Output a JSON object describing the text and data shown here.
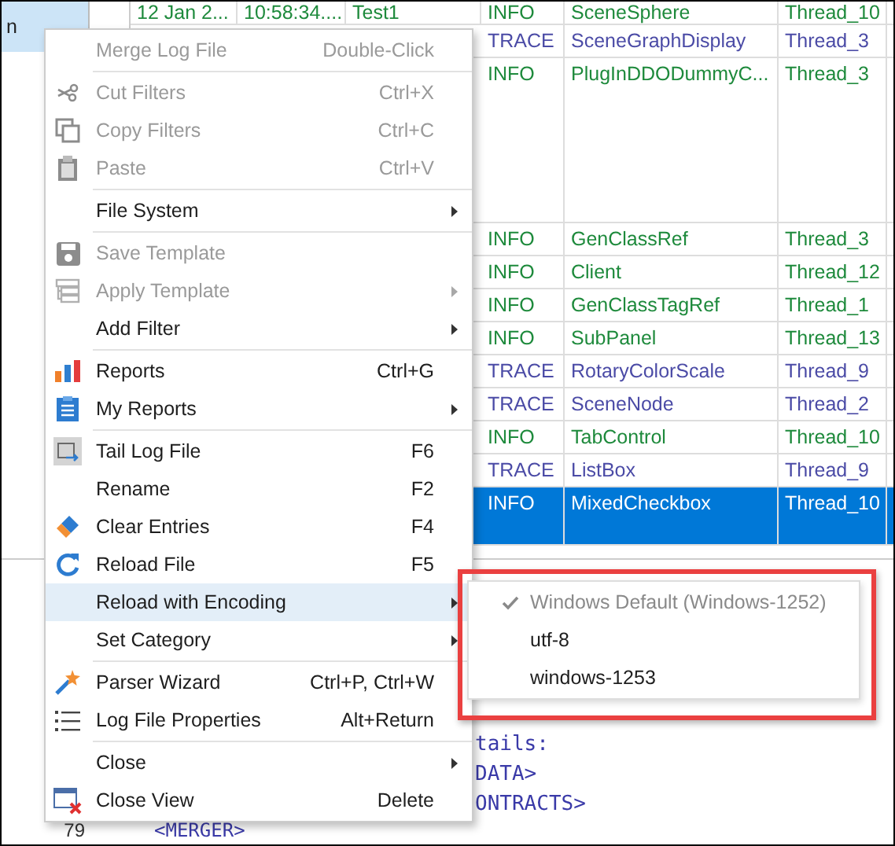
{
  "left_panel": {
    "items": [
      {
        "label": "n",
        "selected": true
      }
    ]
  },
  "table": {
    "rows": [
      {
        "cells": [
          "12 Jan 2...",
          "10:58:34....",
          "Test1",
          "INFO",
          "SceneSphere",
          "Thread_10"
        ],
        "color": "#1e8a3c",
        "kind": "cut",
        "selected": false
      },
      {
        "cells": [
          "TRACE",
          "SceneGraphDisplay",
          "Thread_3"
        ],
        "color": "#4b4ba6",
        "kind": "single",
        "selected": false
      },
      {
        "cells": [
          "INFO",
          "PlugInDDODummyC...",
          "Thread_3"
        ],
        "color": "#1e8a3c",
        "kind": "multi",
        "selected": false
      },
      {
        "cells": [
          "INFO",
          "GenClassRef",
          "Thread_3"
        ],
        "color": "#1e8a3c",
        "kind": "single",
        "selected": false
      },
      {
        "cells": [
          "INFO",
          "Client",
          "Thread_12"
        ],
        "color": "#1e8a3c",
        "kind": "single",
        "selected": false
      },
      {
        "cells": [
          "INFO",
          "GenClassTagRef",
          "Thread_1"
        ],
        "color": "#1e8a3c",
        "kind": "single",
        "selected": false
      },
      {
        "cells": [
          "INFO",
          "SubPanel",
          "Thread_13"
        ],
        "color": "#1e8a3c",
        "kind": "single",
        "selected": false
      },
      {
        "cells": [
          "TRACE",
          "RotaryColorScale",
          "Thread_9"
        ],
        "color": "#4b4ba6",
        "kind": "single",
        "selected": false
      },
      {
        "cells": [
          "TRACE",
          "SceneNode",
          "Thread_2"
        ],
        "color": "#4b4ba6",
        "kind": "single",
        "selected": false
      },
      {
        "cells": [
          "INFO",
          "TabControl",
          "Thread_10"
        ],
        "color": "#1e8a3c",
        "kind": "single",
        "selected": false
      },
      {
        "cells": [
          "TRACE",
          "ListBox",
          "Thread_9"
        ],
        "color": "#4b4ba6",
        "kind": "single",
        "selected": false
      },
      {
        "cells": [
          "INFO",
          "MixedCheckbox",
          "Thread_10"
        ],
        "kind": "double",
        "selected": true
      }
    ]
  },
  "editor": {
    "lines": [
      "tails:",
      "DATA>",
      "ONTRACTS>"
    ],
    "last_line": {
      "number": "79",
      "text": "<MERGER>"
    }
  },
  "menu": {
    "items": [
      {
        "kind": "item",
        "label": "Merge Log File",
        "shortcut": "Double-Click",
        "disabled": true,
        "submenu": false,
        "selected": false
      },
      {
        "kind": "separator"
      },
      {
        "kind": "item",
        "label": "Cut Filters",
        "shortcut": "Ctrl+X",
        "disabled": true,
        "submenu": false,
        "selected": false
      },
      {
        "kind": "item",
        "label": "Copy Filters",
        "shortcut": "Ctrl+C",
        "disabled": true,
        "submenu": false,
        "selected": false
      },
      {
        "kind": "item",
        "label": "Paste",
        "shortcut": "Ctrl+V",
        "disabled": true,
        "submenu": false,
        "selected": false
      },
      {
        "kind": "separator"
      },
      {
        "kind": "item",
        "label": "File System",
        "disabled": false,
        "submenu": true,
        "selected": false
      },
      {
        "kind": "separator"
      },
      {
        "kind": "item",
        "label": "Save Template",
        "disabled": true,
        "submenu": false,
        "selected": false
      },
      {
        "kind": "item",
        "label": "Apply Template",
        "disabled": true,
        "submenu": true,
        "selected": false
      },
      {
        "kind": "item",
        "label": "Add Filter",
        "disabled": false,
        "submenu": true,
        "selected": false
      },
      {
        "kind": "separator"
      },
      {
        "kind": "item",
        "label": "Reports",
        "shortcut": "Ctrl+G",
        "disabled": false,
        "submenu": false,
        "selected": false
      },
      {
        "kind": "item",
        "label": "My Reports",
        "disabled": false,
        "submenu": true,
        "selected": false
      },
      {
        "kind": "separator"
      },
      {
        "kind": "item",
        "label": "Tail Log File",
        "shortcut": "F6",
        "disabled": false,
        "submenu": false,
        "selected": false
      },
      {
        "kind": "item",
        "label": "Rename",
        "shortcut": "F2",
        "disabled": false,
        "submenu": false,
        "selected": false
      },
      {
        "kind": "item",
        "label": "Clear Entries",
        "shortcut": "F4",
        "disabled": false,
        "submenu": false,
        "selected": false
      },
      {
        "kind": "item",
        "label": "Reload File",
        "shortcut": "F5",
        "disabled": false,
        "submenu": false,
        "selected": false
      },
      {
        "kind": "item",
        "label": "Reload with Encoding",
        "disabled": false,
        "submenu": true,
        "selected": true
      },
      {
        "kind": "item",
        "label": "Set Category",
        "disabled": false,
        "submenu": true,
        "selected": false
      },
      {
        "kind": "separator"
      },
      {
        "kind": "item",
        "label": "Parser Wizard",
        "shortcut": "Ctrl+P, Ctrl+W",
        "disabled": false,
        "submenu": false,
        "selected": false
      },
      {
        "kind": "item",
        "label": "Log File Properties",
        "shortcut": "Alt+Return",
        "disabled": false,
        "submenu": false,
        "selected": false
      },
      {
        "kind": "separator"
      },
      {
        "kind": "item",
        "label": "Close",
        "disabled": false,
        "submenu": true,
        "selected": false
      },
      {
        "kind": "item",
        "label": "Close View",
        "shortcut": "Delete",
        "disabled": false,
        "submenu": false,
        "selected": false
      }
    ]
  },
  "submenu": {
    "items": [
      {
        "label": "Windows Default (Windows-1252)",
        "checked": true,
        "disabled": true
      },
      {
        "label": "utf-8",
        "checked": false,
        "disabled": false
      },
      {
        "label": "windows-1253",
        "checked": false,
        "disabled": false
      }
    ]
  }
}
